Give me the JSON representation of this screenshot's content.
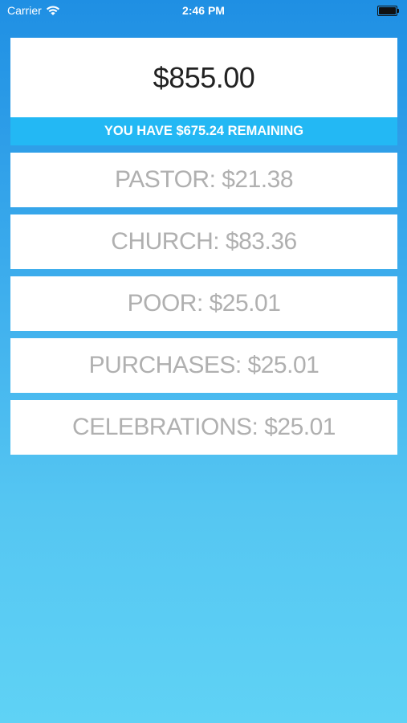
{
  "status_bar": {
    "carrier": "Carrier",
    "time": "2:46 PM",
    "wifi_icon": "wifi-icon",
    "battery_icon": "battery-icon"
  },
  "summary": {
    "total": "$855.00",
    "remaining_label": "YOU HAVE $675.24 REMAINING",
    "remaining_bar_color": "#23b8f4"
  },
  "categories": [
    {
      "label": "PASTOR: $21.38"
    },
    {
      "label": "CHURCH: $83.36"
    },
    {
      "label": "POOR: $25.01"
    },
    {
      "label": "PURCHASES: $25.01"
    },
    {
      "label": "CELEBRATIONS: $25.01"
    }
  ],
  "colors": {
    "background_top": "#1f8fe3",
    "background_bottom": "#5fd2f5",
    "category_text": "#b0b0b0"
  }
}
